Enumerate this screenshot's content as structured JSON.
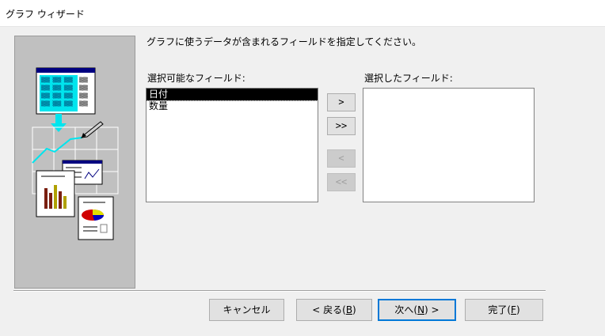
{
  "window": {
    "title": "グラフ ウィザード"
  },
  "instruction": "グラフに使うデータが含まれるフィールドを指定してください。",
  "available": {
    "label": "選択可能なフィールド:",
    "items": [
      {
        "label": "日付",
        "selected": true
      },
      {
        "label": "数量",
        "selected": false
      }
    ]
  },
  "selected": {
    "label": "選択したフィールド:",
    "items": []
  },
  "move_buttons": {
    "add_one": ">",
    "add_all": ">>",
    "remove_one": "<",
    "remove_all": "<<"
  },
  "footer": {
    "cancel": "キャンセル",
    "back": {
      "prefix": "< 戻る(",
      "key": "B",
      "suffix": ")"
    },
    "next": {
      "prefix": "次へ(",
      "key": "N",
      "suffix": ") >"
    },
    "finish": {
      "prefix": "完了(",
      "key": "F",
      "suffix": ")"
    }
  },
  "colors": {
    "selection": "#000000",
    "default_button_border": "#0078d7",
    "illustration_bg": "#c0c0c0"
  }
}
